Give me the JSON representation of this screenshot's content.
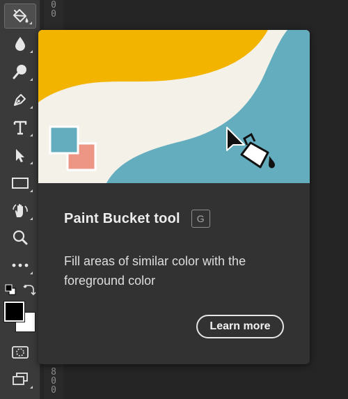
{
  "tooltip": {
    "title": "Paint Bucket tool",
    "shortcut": "G",
    "description": "Fill areas of similar color with the foreground color",
    "learn_more_label": "Learn more"
  },
  "ruler": {
    "top_digits": "0\n0",
    "bottom_digits": "8\n0\n0"
  },
  "toolbar": {
    "tools": [
      {
        "name": "paint-bucket-icon",
        "active": true
      },
      {
        "name": "blur-icon",
        "active": false
      },
      {
        "name": "dodge-icon",
        "active": false
      },
      {
        "name": "pen-icon",
        "active": false
      },
      {
        "name": "type-icon",
        "active": false
      },
      {
        "name": "path-selection-icon",
        "active": false
      },
      {
        "name": "rectangle-icon",
        "active": false
      },
      {
        "name": "hand-rotate-icon",
        "active": false
      },
      {
        "name": "zoom-icon",
        "active": false
      },
      {
        "name": "more-tools-icon",
        "active": false
      },
      {
        "name": "default-colors-icon",
        "active": false
      },
      {
        "name": "swap-colors-icon",
        "active": false
      },
      {
        "name": "quick-mask-icon",
        "active": false
      },
      {
        "name": "screen-mode-icon",
        "active": false
      }
    ],
    "foreground_color": "#000000",
    "background_color": "#ffffff"
  },
  "colors": {
    "illustration_yellow": "#f3b400",
    "illustration_cream": "#f3f1e8",
    "illustration_teal": "#64adbf",
    "illustration_salmon": "#ee9686",
    "card_bg": "#323232"
  }
}
